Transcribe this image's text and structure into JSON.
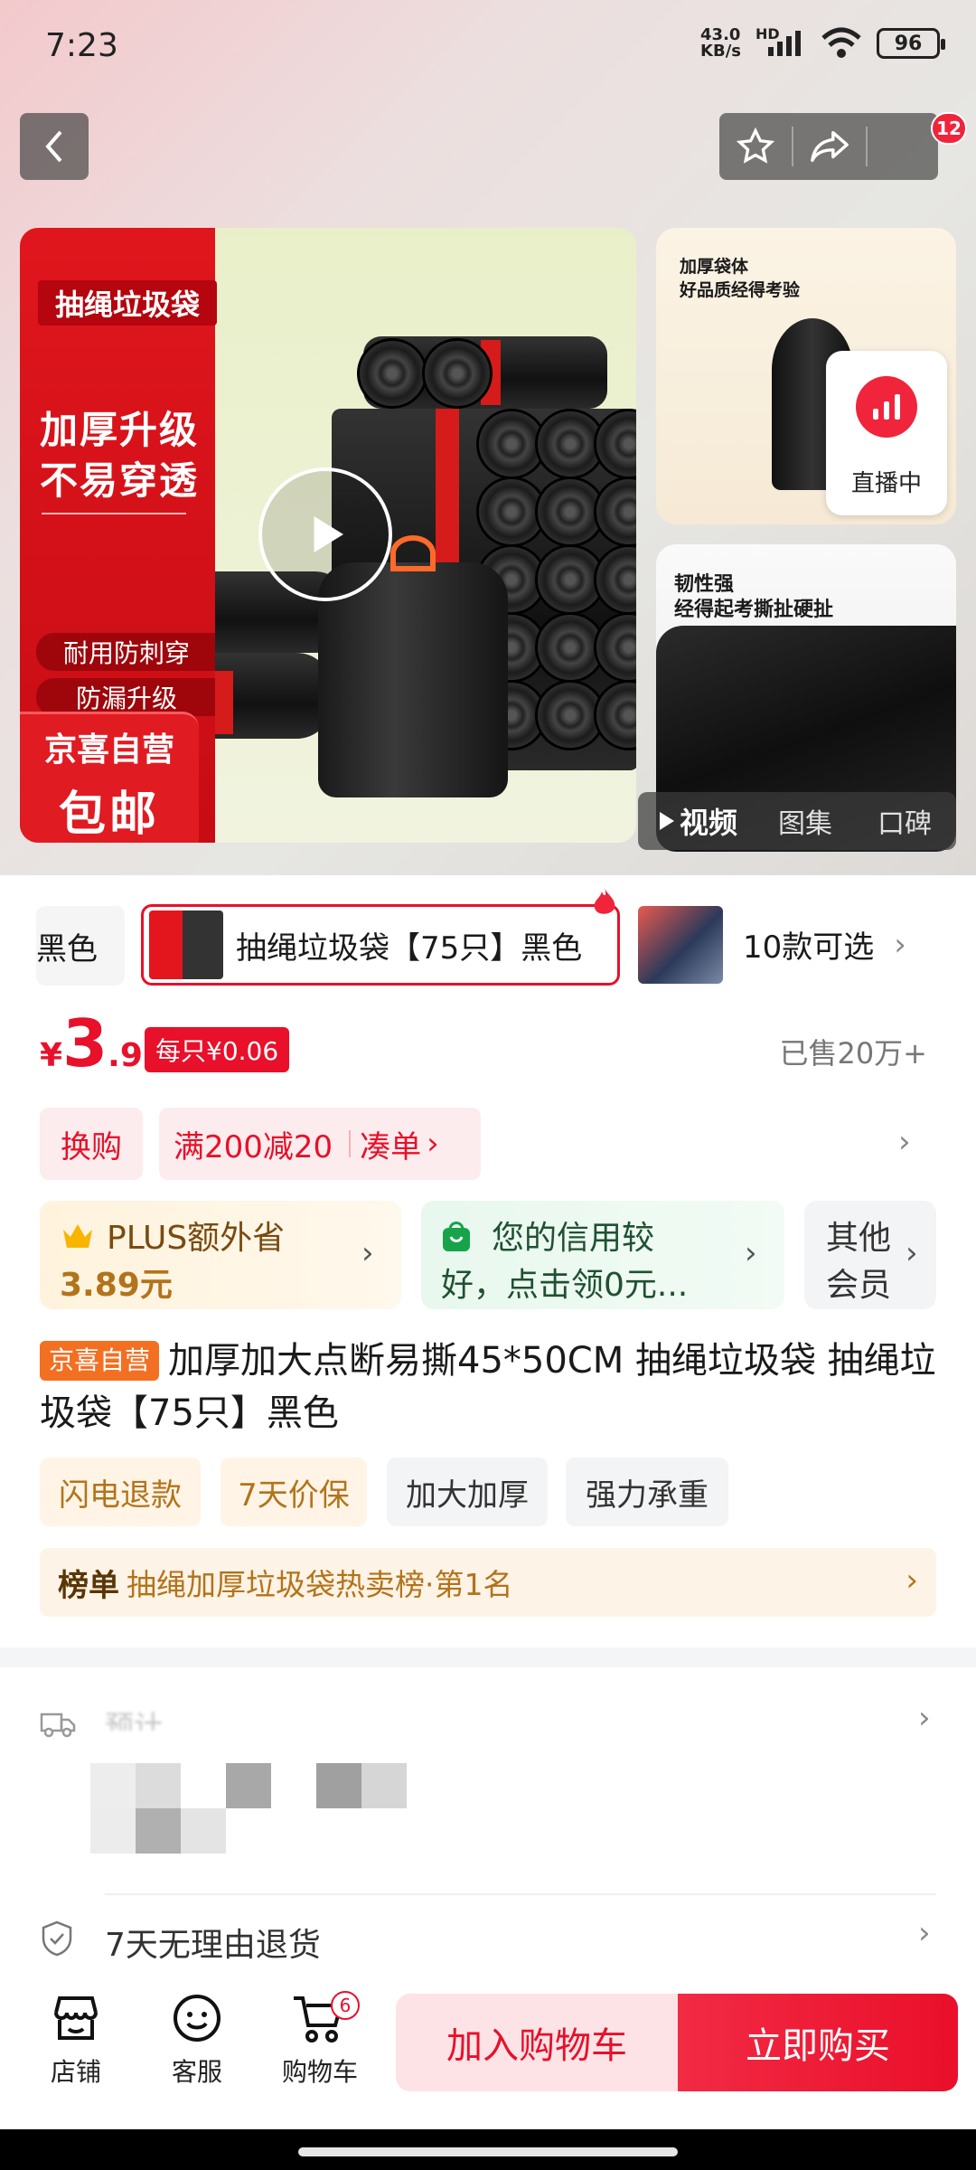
{
  "status": {
    "time": "7:23",
    "net_speed_value": "43.0",
    "net_speed_unit": "KB/s",
    "signal_label": "HD",
    "battery": "96"
  },
  "topbar": {
    "cart_count": "12"
  },
  "main_image": {
    "red_tag": "抽绳垃圾袋",
    "headline_1": "加厚升级",
    "headline_2": "不易穿透",
    "feature_1": "耐用防刺穿",
    "feature_2": "防漏升级",
    "brand_line": "京喜自营",
    "shipping": "包邮"
  },
  "side_image_1": {
    "caption_1": "加厚袋体",
    "caption_2": "好品质经得考验",
    "live_label": "直播中"
  },
  "side_image_2": {
    "caption_1": "韧性强",
    "caption_2": "经得起考撕扯硬扯"
  },
  "media_tabs": {
    "video": "视频",
    "gallery": "图集",
    "reviews": "口碑"
  },
  "variants": {
    "prev_label": "黑色",
    "selected_label": "抽绳垃圾袋【75只】黑色",
    "more_label": "10款可选"
  },
  "price": {
    "currency": "¥",
    "integer": "3",
    "decimal": ".9",
    "unit_price": "每只¥0.06",
    "sold": "已售20万+"
  },
  "promo": {
    "swap": "换购",
    "discount": "满200减20",
    "bundle": "凑单"
  },
  "membership": {
    "plus_line1": "PLUS额外省",
    "plus_line2": "3.89元",
    "credit_line1": "您的信用较",
    "credit_line2": "好，点击领0元...",
    "other_line1": "其他",
    "other_line2": "会员"
  },
  "title": {
    "store_badge": "京喜自营",
    "text": "加厚加大点断易撕45*50CM 抽绳垃圾袋 抽绳垃圾袋【75只】黑色"
  },
  "tags": [
    "闪电退款",
    "7天价保",
    "加大加厚",
    "强力承重"
  ],
  "ranking": {
    "label": "榜单",
    "text": "抽绳加厚垃圾袋热卖榜·第1名"
  },
  "delivery": {
    "label": "预计"
  },
  "returns": {
    "text": "7天无理由退货"
  },
  "bottom_nav": {
    "shop": "店铺",
    "service": "客服",
    "cart": "购物车",
    "cart_count": "6"
  },
  "actions": {
    "add_to_cart": "加入购物车",
    "buy_now": "立即购买"
  },
  "colors": {
    "accent": "#e8102a",
    "gold": "#b3731a",
    "green": "#17a34a"
  }
}
